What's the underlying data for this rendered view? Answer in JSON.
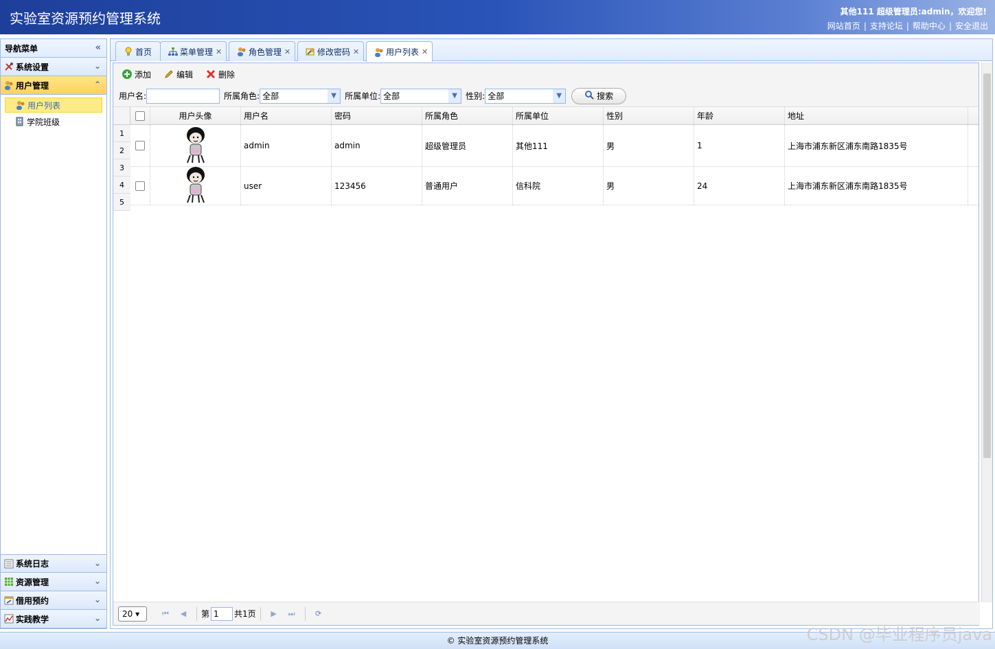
{
  "header": {
    "title": "实验室资源预约管理系统",
    "welcome": "其他111 超级管理员:admin，欢迎您!",
    "links": [
      "网站首页",
      "支持论坛",
      "帮助中心",
      "安全退出"
    ]
  },
  "sidebar": {
    "title": "导航菜单",
    "panels": [
      {
        "label": "系统设置",
        "icon": "tools-icon"
      },
      {
        "label": "用户管理",
        "icon": "users-icon",
        "active": true
      }
    ],
    "tree": [
      {
        "label": "用户列表",
        "icon": "user-icon",
        "selected": true
      },
      {
        "label": "学院班级",
        "icon": "building-icon"
      }
    ],
    "bottom_panels": [
      {
        "label": "系统日志",
        "icon": "log-icon"
      },
      {
        "label": "资源管理",
        "icon": "grid-icon"
      },
      {
        "label": "借用预约",
        "icon": "calendar-icon"
      },
      {
        "label": "实践教学",
        "icon": "chart-icon"
      }
    ]
  },
  "tabs": [
    {
      "label": "首页",
      "icon": "bulb-icon",
      "closable": false
    },
    {
      "label": "菜单管理",
      "icon": "tree-icon",
      "closable": true
    },
    {
      "label": "角色管理",
      "icon": "users-icon",
      "closable": true
    },
    {
      "label": "修改密码",
      "icon": "key-icon",
      "closable": true
    },
    {
      "label": "用户列表",
      "icon": "users-icon",
      "closable": true,
      "active": true
    }
  ],
  "toolbar": {
    "add": "添加",
    "edit": "编辑",
    "delete": "删除"
  },
  "search": {
    "username_label": "用户名:",
    "username_value": "",
    "role_label": "所属角色:",
    "role_value": "全部",
    "unit_label": "所属单位:",
    "unit_value": "全部",
    "gender_label": "性别:",
    "gender_value": "全部",
    "search_button": "搜索"
  },
  "grid": {
    "columns": [
      "用户头像",
      "用户名",
      "密码",
      "所属角色",
      "所属单位",
      "性别",
      "年龄",
      "地址"
    ],
    "row_numbers": [
      "1",
      "2",
      "3",
      "4",
      "5"
    ],
    "rows": [
      {
        "username": "admin",
        "password": "admin",
        "role": "超级管理员",
        "unit": "其他111",
        "gender": "男",
        "age": "1",
        "address": "上海市浦东新区浦东南路1835号"
      },
      {
        "username": "user",
        "password": "123456",
        "role": "普通用户",
        "unit": "信科院",
        "gender": "男",
        "age": "24",
        "address": "上海市浦东新区浦东南路1835号"
      }
    ]
  },
  "pager": {
    "page_size": "20",
    "page_prefix": "第",
    "page_value": "1",
    "page_total": "共1页"
  },
  "footer": {
    "text": "© 实验室资源预约管理系统"
  },
  "watermark": "CSDN @毕业程序员java",
  "colors": {
    "header_blue": "#1d3f9a",
    "border": "#99bbe8",
    "selected_yellow": "#fbec88"
  }
}
